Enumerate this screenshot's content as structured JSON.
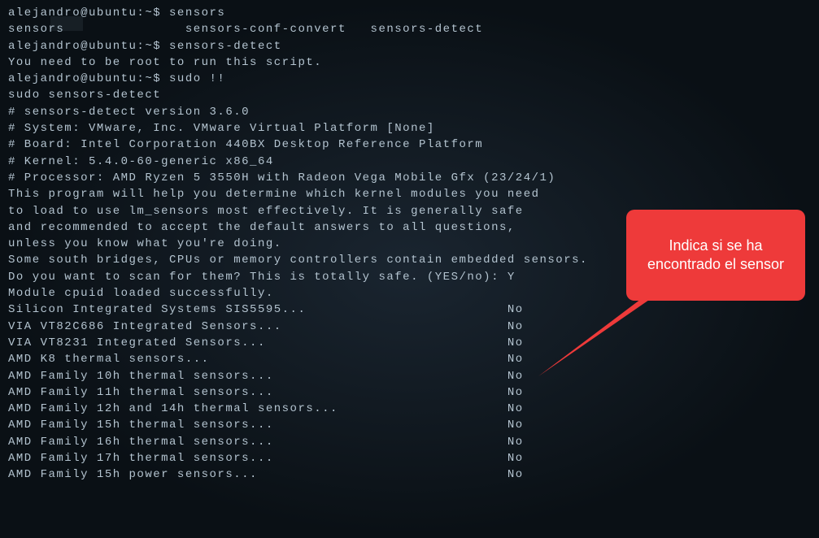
{
  "prompt1": "alejandro@ubuntu:~$ sensors",
  "completion_line": "sensors               sensors-conf-convert   sensors-detect",
  "prompt2": "alejandro@ubuntu:~$ sensors-detect",
  "root_msg": "You need to be root to run this script.",
  "prompt3": "alejandro@ubuntu:~$ sudo !!",
  "sudo_echo": "sudo sensors-detect",
  "version_line": "# sensors-detect version 3.6.0",
  "system_line": "# System: VMware, Inc. VMware Virtual Platform [None]",
  "board_line": "# Board: Intel Corporation 440BX Desktop Reference Platform",
  "kernel_line": "# Kernel: 5.4.0-60-generic x86_64",
  "processor_line": "# Processor: AMD Ryzen 5 3550H with Radeon Vega Mobile Gfx (23/24/1)",
  "blank1": "",
  "help1": "This program will help you determine which kernel modules you need",
  "help2": "to load to use lm_sensors most effectively. It is generally safe",
  "help3": "and recommended to accept the default answers to all questions,",
  "help4": "unless you know what you're doing.",
  "blank2": "",
  "south1": "Some south bridges, CPUs or memory controllers contain embedded sensors.",
  "south2": "Do you want to scan for them? This is totally safe. (YES/no): Y",
  "module_loaded": "Module cpuid loaded successfully.",
  "sensors": [
    {
      "name": "Silicon Integrated Systems SIS5595...",
      "result": "No"
    },
    {
      "name": "VIA VT82C686 Integrated Sensors...",
      "result": "No"
    },
    {
      "name": "VIA VT8231 Integrated Sensors...",
      "result": "No"
    },
    {
      "name": "AMD K8 thermal sensors...",
      "result": "No"
    },
    {
      "name": "AMD Family 10h thermal sensors...",
      "result": "No"
    },
    {
      "name": "AMD Family 11h thermal sensors...",
      "result": "No"
    },
    {
      "name": "AMD Family 12h and 14h thermal sensors...",
      "result": "No"
    },
    {
      "name": "AMD Family 15h thermal sensors...",
      "result": "No"
    },
    {
      "name": "AMD Family 16h thermal sensors...",
      "result": "No"
    },
    {
      "name": "AMD Family 17h thermal sensors...",
      "result": "No"
    },
    {
      "name": "AMD Family 15h power sensors...",
      "result": "No"
    }
  ],
  "callout_text": "Indica si se ha encontrado el sensor"
}
